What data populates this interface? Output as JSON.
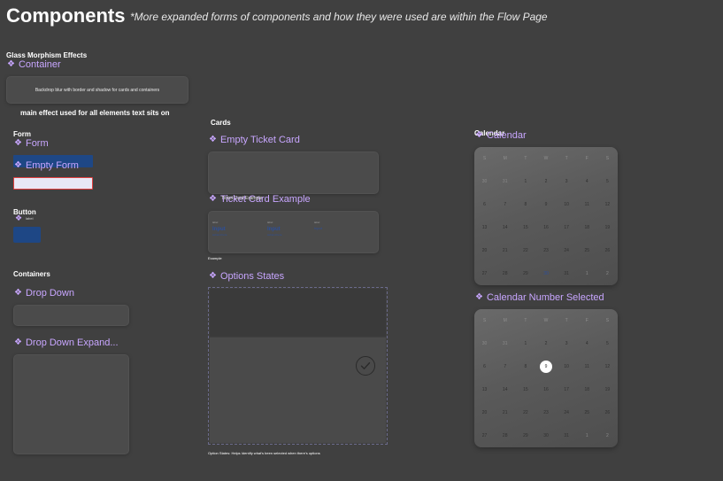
{
  "header": {
    "title": "Components",
    "subtitle": "*More expanded forms of components and how they were used are within the Flow Page"
  },
  "glass": {
    "section": "Glass Morphism Effects",
    "component": "Container",
    "container_text": "Backdrop blur with border and shadow for cards and containers",
    "note": "main effect used for all elements text sits on"
  },
  "form": {
    "section": "Form",
    "component": "Form",
    "empty_component": "Empty Form",
    "field_value": "label"
  },
  "button": {
    "section": "Button",
    "label": "label"
  },
  "containers": {
    "section": "Containers",
    "dropdown": "Drop Down",
    "dropdown_expanded": "Drop Down Expand..."
  },
  "cards": {
    "section": "Cards",
    "empty_ticket": "Empty Ticket Card",
    "ticket_example": "Ticket Card Example",
    "ticket_overlap": "Ticket Card Example",
    "ticket_cells": [
      {
        "small": "label",
        "big": "Input",
        "sub": "subtext here"
      },
      {
        "small": "label",
        "big": "Input",
        "sub": "subtext here"
      },
      {
        "small": "label",
        "big": "Input",
        "sub": ""
      }
    ],
    "example_caption": "Example",
    "options_states": "Options States",
    "options_caption": "Option States: Helps Identify what's been selected when there's options"
  },
  "calendar": {
    "section": "Calendar",
    "component": "Calendar",
    "selected_component": "Calendar Number Selected",
    "weekdays": [
      "S",
      "M",
      "T",
      "W",
      "T",
      "F",
      "S"
    ],
    "weeks": [
      [
        "30",
        "31",
        "1",
        "2",
        "3",
        "4",
        "5"
      ],
      [
        "6",
        "7",
        "8",
        "9",
        "10",
        "11",
        "12"
      ],
      [
        "13",
        "14",
        "15",
        "16",
        "17",
        "18",
        "19"
      ],
      [
        "20",
        "21",
        "22",
        "23",
        "24",
        "25",
        "26"
      ],
      [
        "27",
        "28",
        "29",
        "30",
        "31",
        "1",
        "2"
      ]
    ],
    "selected_day": "9"
  },
  "colors": {
    "background": "#404040",
    "accent_purple": "#c8a6ff",
    "button_blue": "#1e4785",
    "field_fill": "#e8e8f6",
    "field_border": "#e04040"
  }
}
